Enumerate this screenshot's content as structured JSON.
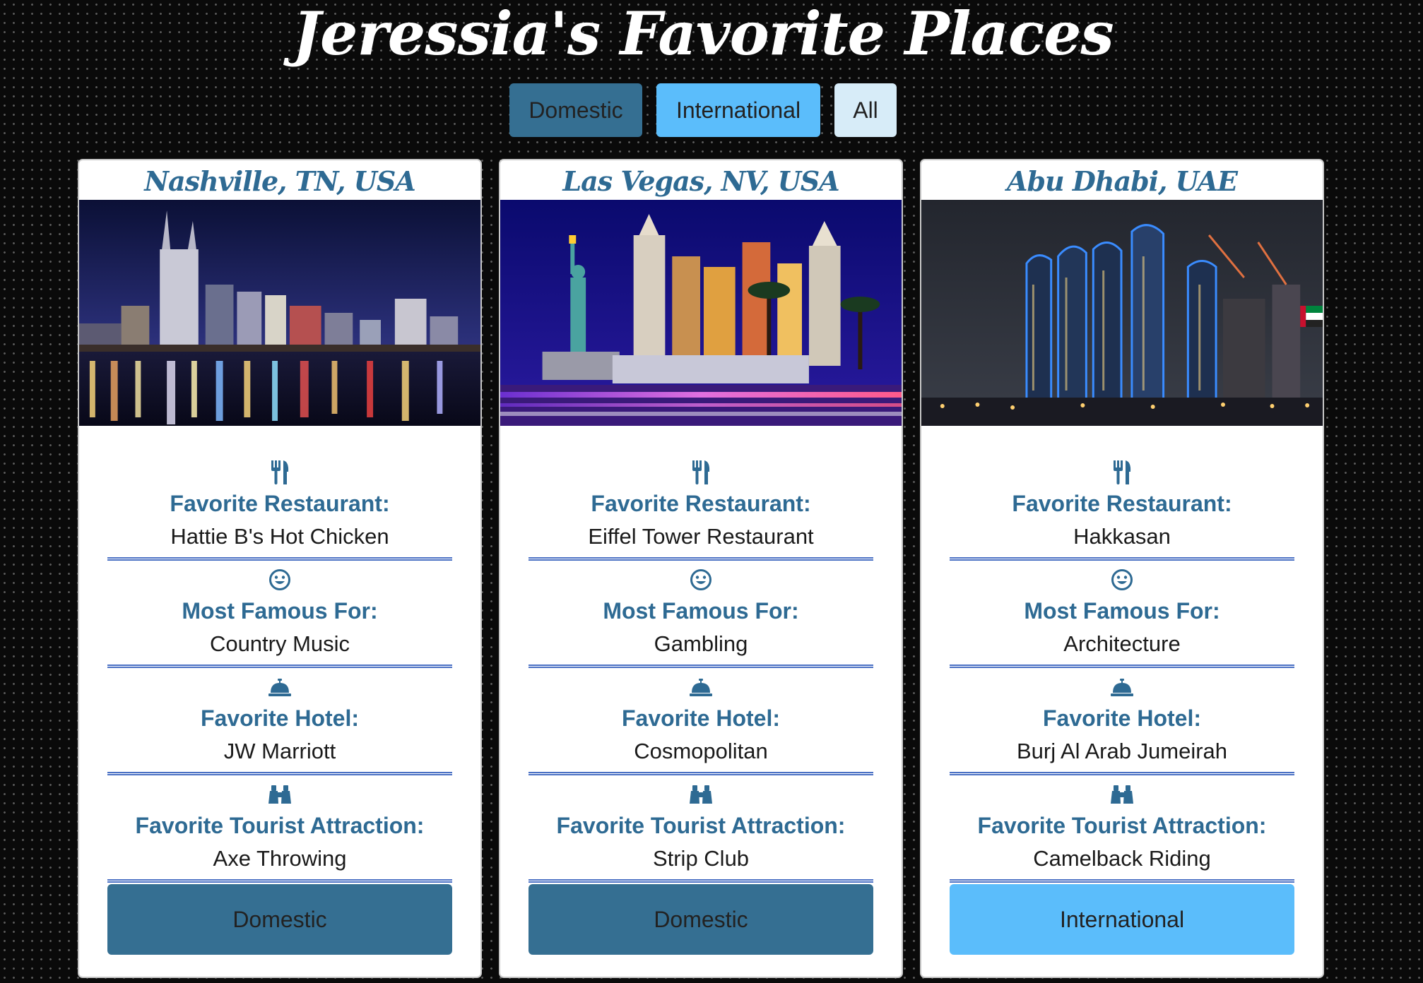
{
  "page": {
    "title": "Jeressia's Favorite Places"
  },
  "filters": [
    {
      "label": "Domestic",
      "color": "#356f92"
    },
    {
      "label": "International",
      "color": "#5bbdfb"
    },
    {
      "label": "All",
      "color": "#d7ecf8"
    }
  ],
  "labels": {
    "restaurant": "Favorite Restaurant:",
    "famous_for": "Most Famous For:",
    "hotel": "Favorite Hotel:",
    "attraction": "Favorite Tourist Attraction:"
  },
  "icons": {
    "restaurant": "utensils-icon",
    "famous_for": "smile-icon",
    "hotel": "concierge-bell-icon",
    "attraction": "binoculars-icon"
  },
  "places": [
    {
      "title": "Nashville, TN, USA",
      "image": "nashville-skyline-night",
      "restaurant": "Hattie B's Hot Chicken",
      "famous_for": "Country Music",
      "hotel": "JW Marriott",
      "attraction": "Axe Throwing",
      "category": "Domestic"
    },
    {
      "title": "Las Vegas, NV, USA",
      "image": "las-vegas-new-york-new-york-casino",
      "restaurant": "Eiffel Tower Restaurant",
      "famous_for": "Gambling",
      "hotel": "Cosmopolitan",
      "attraction": "Strip Club",
      "category": "Domestic"
    },
    {
      "title": "Abu Dhabi, UAE",
      "image": "abu-dhabi-etihad-towers",
      "restaurant": "Hakkasan",
      "famous_for": "Architecture",
      "hotel": "Burj Al Arab Jumeirah",
      "attraction": "Camelback Riding",
      "category": "International"
    }
  ],
  "colors": {
    "accent": "#2e6a93",
    "domestic": "#356f92",
    "international": "#5bbdfb",
    "all": "#d7ecf8",
    "divider": "#4b71c4"
  }
}
